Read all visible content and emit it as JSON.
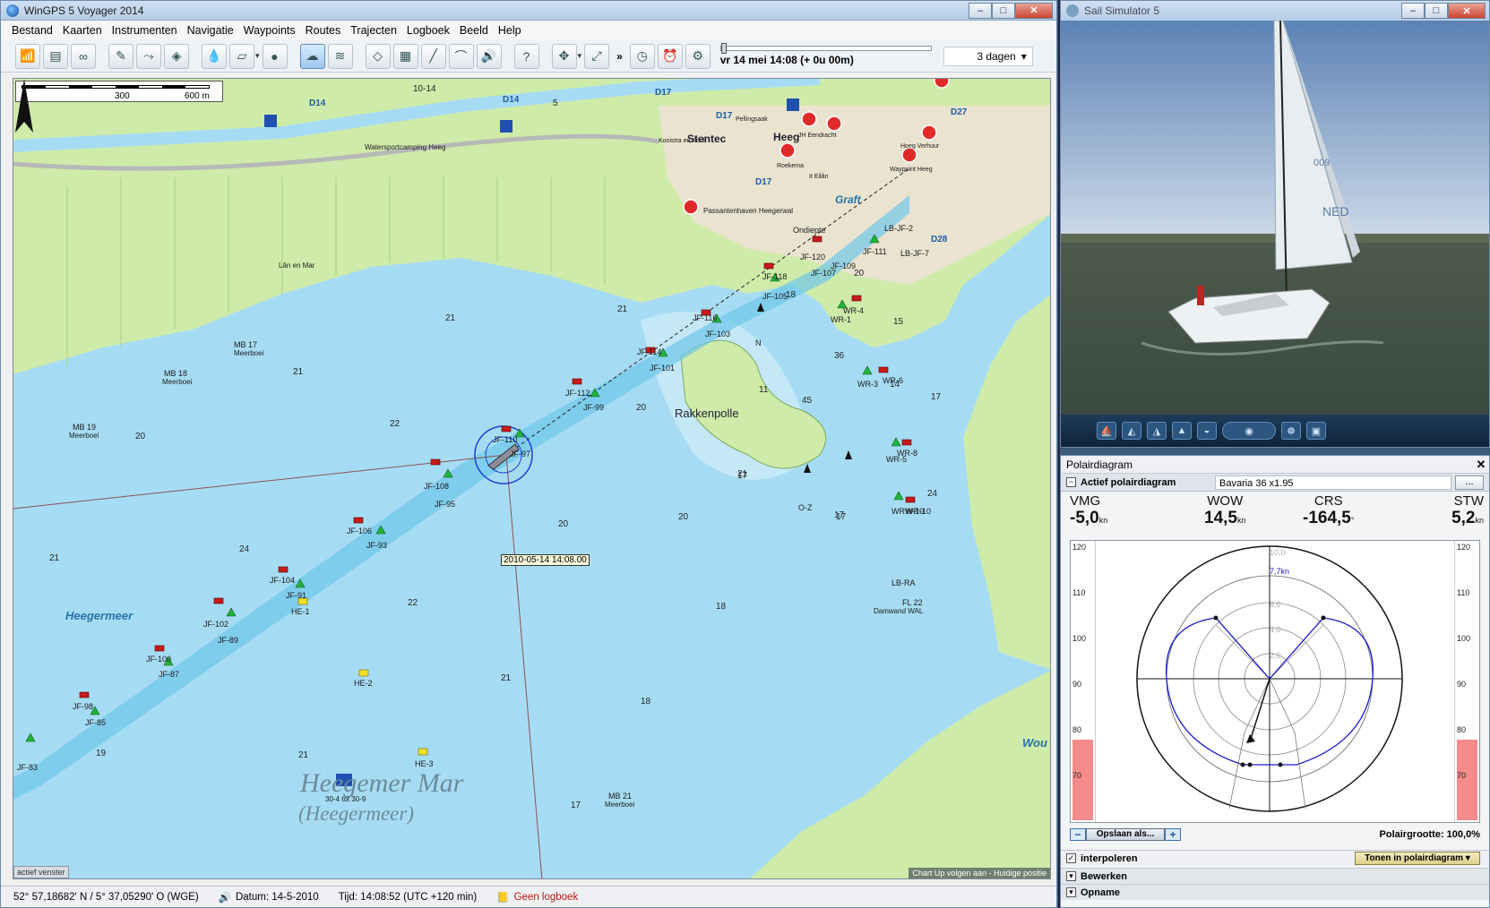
{
  "main_window": {
    "title": "WinGPS 5 Voyager 2014",
    "minimize": "–",
    "maximize": "□",
    "close": "✕"
  },
  "menu": [
    "Bestand",
    "Kaarten",
    "Instrumenten",
    "Navigatie",
    "Waypoints",
    "Routes",
    "Trajecten",
    "Logboek",
    "Beeld",
    "Help"
  ],
  "toolbar": {
    "icons": [
      "gps-icon",
      "instruments-icon",
      "binoculars-icon",
      "pencil-icon",
      "route-icon",
      "waypoint-icon",
      "droplet-icon",
      "layers-icon",
      "globe-icon",
      "weather-icon",
      "tide-icon",
      "ais-icon",
      "chart-icon",
      "ruler-icon",
      "bridge-icon",
      "sound-icon",
      "help-icon",
      "move-icon",
      "track-icon",
      "timer-icon",
      "alarm-icon",
      "wheel-icon"
    ],
    "more": "»",
    "time_text": "vr 14 mei 14:08  (+ 0u 00m)",
    "time_progress": 0.0,
    "days_select": "3 dagen"
  },
  "map": {
    "scale_labels": [
      "0",
      "300",
      "600 m"
    ],
    "place_labels": [
      "Heeg",
      "Stentec",
      "Ondiepte",
      "Graft",
      "Rakkenpolle",
      "Heegermeer",
      "Heegemer Mar",
      "(Heegermeer)",
      "Wou"
    ],
    "buoy_labels": [
      "JF-118",
      "JF-105",
      "JF-120",
      "JF-107",
      "JF-109",
      "JF-111",
      "JF-116",
      "JF-103",
      "JF-114",
      "JF-101",
      "JF-112",
      "JF-99",
      "JF-110",
      "JF-97",
      "JF-108",
      "JF-95",
      "JF-106",
      "JF-93",
      "JF-104",
      "JF-91",
      "JF-102",
      "JF-89",
      "JF-100",
      "JF-87",
      "JF-98",
      "JF-85",
      "JF-83",
      "HE-1",
      "HE-2",
      "HE-3",
      "WR-4",
      "WR-1",
      "WR-6",
      "WR-3",
      "WR-8",
      "WR-5",
      "WR-10",
      "WRW-10",
      "LB-JF-2",
      "LB-JF-7",
      "LB-RA",
      "MB 17",
      "MB 18",
      "MB 19",
      "MB 21",
      "O-Z",
      "N",
      "FL 22"
    ],
    "small_labels": [
      "Meerboei",
      "Watersportcamping Heeg",
      "Lân en Mar",
      "Passantenhaven Heegerwal",
      "Damwand WAL",
      "30-4 tot 30-9",
      "Kooistra en Knol",
      "JH Eendracht",
      "Hoeg Verhuur",
      "Waypoint Heeg",
      "Roekema",
      "It Eilân",
      "Pellingsaak"
    ],
    "depths": [
      "10-14",
      "5",
      "21",
      "21",
      "22",
      "20",
      "21",
      "24",
      "22",
      "21",
      "21",
      "19",
      "20",
      "20",
      "20",
      "21",
      "18",
      "18",
      "17",
      "21",
      "17",
      "11",
      "45",
      "36",
      "14",
      "17",
      "15",
      "20",
      "18",
      "24",
      "17",
      "17"
    ],
    "track_timestamp": "2010-05-14 14:08.00",
    "channel_ids": [
      "D14",
      "D14",
      "D17",
      "D17",
      "D17",
      "D27",
      "D28"
    ],
    "status_left": "actief venster",
    "status_right": "Chart Up volgen aan - Huidige positie"
  },
  "statusbar": {
    "position": "52° 57,18682' N / 5° 37,05290' O (WGE)",
    "date": "Datum:  14-5-2010",
    "time": "Tijd:  14:08:52 (UTC +120 min)",
    "logbook": "Geen logboek"
  },
  "sim_window": {
    "title": "Sail Simulator 5",
    "sail_number_1": "009",
    "sail_number_2": "NED",
    "dash_icons": [
      "sail-trim-icon",
      "jib-icon",
      "main-icon",
      "reef-icon",
      "spinnaker-icon",
      "compass-icon",
      "helm-icon",
      "camera-icon"
    ]
  },
  "polar_panel": {
    "title": "Polairdiagram",
    "active_label": "Actief polairdiagram",
    "boat": "Bavaria 36 x1.95",
    "dots": "...",
    "readouts": [
      {
        "key": "VMG",
        "value": "-5,0",
        "unit": "kn"
      },
      {
        "key": "WOW",
        "value": "14,5",
        "unit": "kn"
      },
      {
        "key": "CRS",
        "value": "-164,5",
        "unit": "°"
      },
      {
        "key": "STW",
        "value": "5,2",
        "unit": "kn"
      }
    ],
    "gauge_ticks": [
      "120",
      "110",
      "100",
      "90",
      "80",
      "70"
    ],
    "gauge_left_level": 0.29,
    "gauge_right_level": 0.29,
    "ring_labels": [
      "10,0",
      "7,7kn",
      "6,0",
      "4,0",
      "2,0"
    ],
    "save_label": "Opslaan als...",
    "polar_size": "Polairgrootte: 100,0%",
    "interpolate_label": "interpoleren",
    "show_button": "Tonen in polairdiagram",
    "edit_label": "Bewerken",
    "record_label": "Opname",
    "colors": {
      "polar": "#1a1ad0",
      "gauge": "#f58a8a"
    }
  }
}
